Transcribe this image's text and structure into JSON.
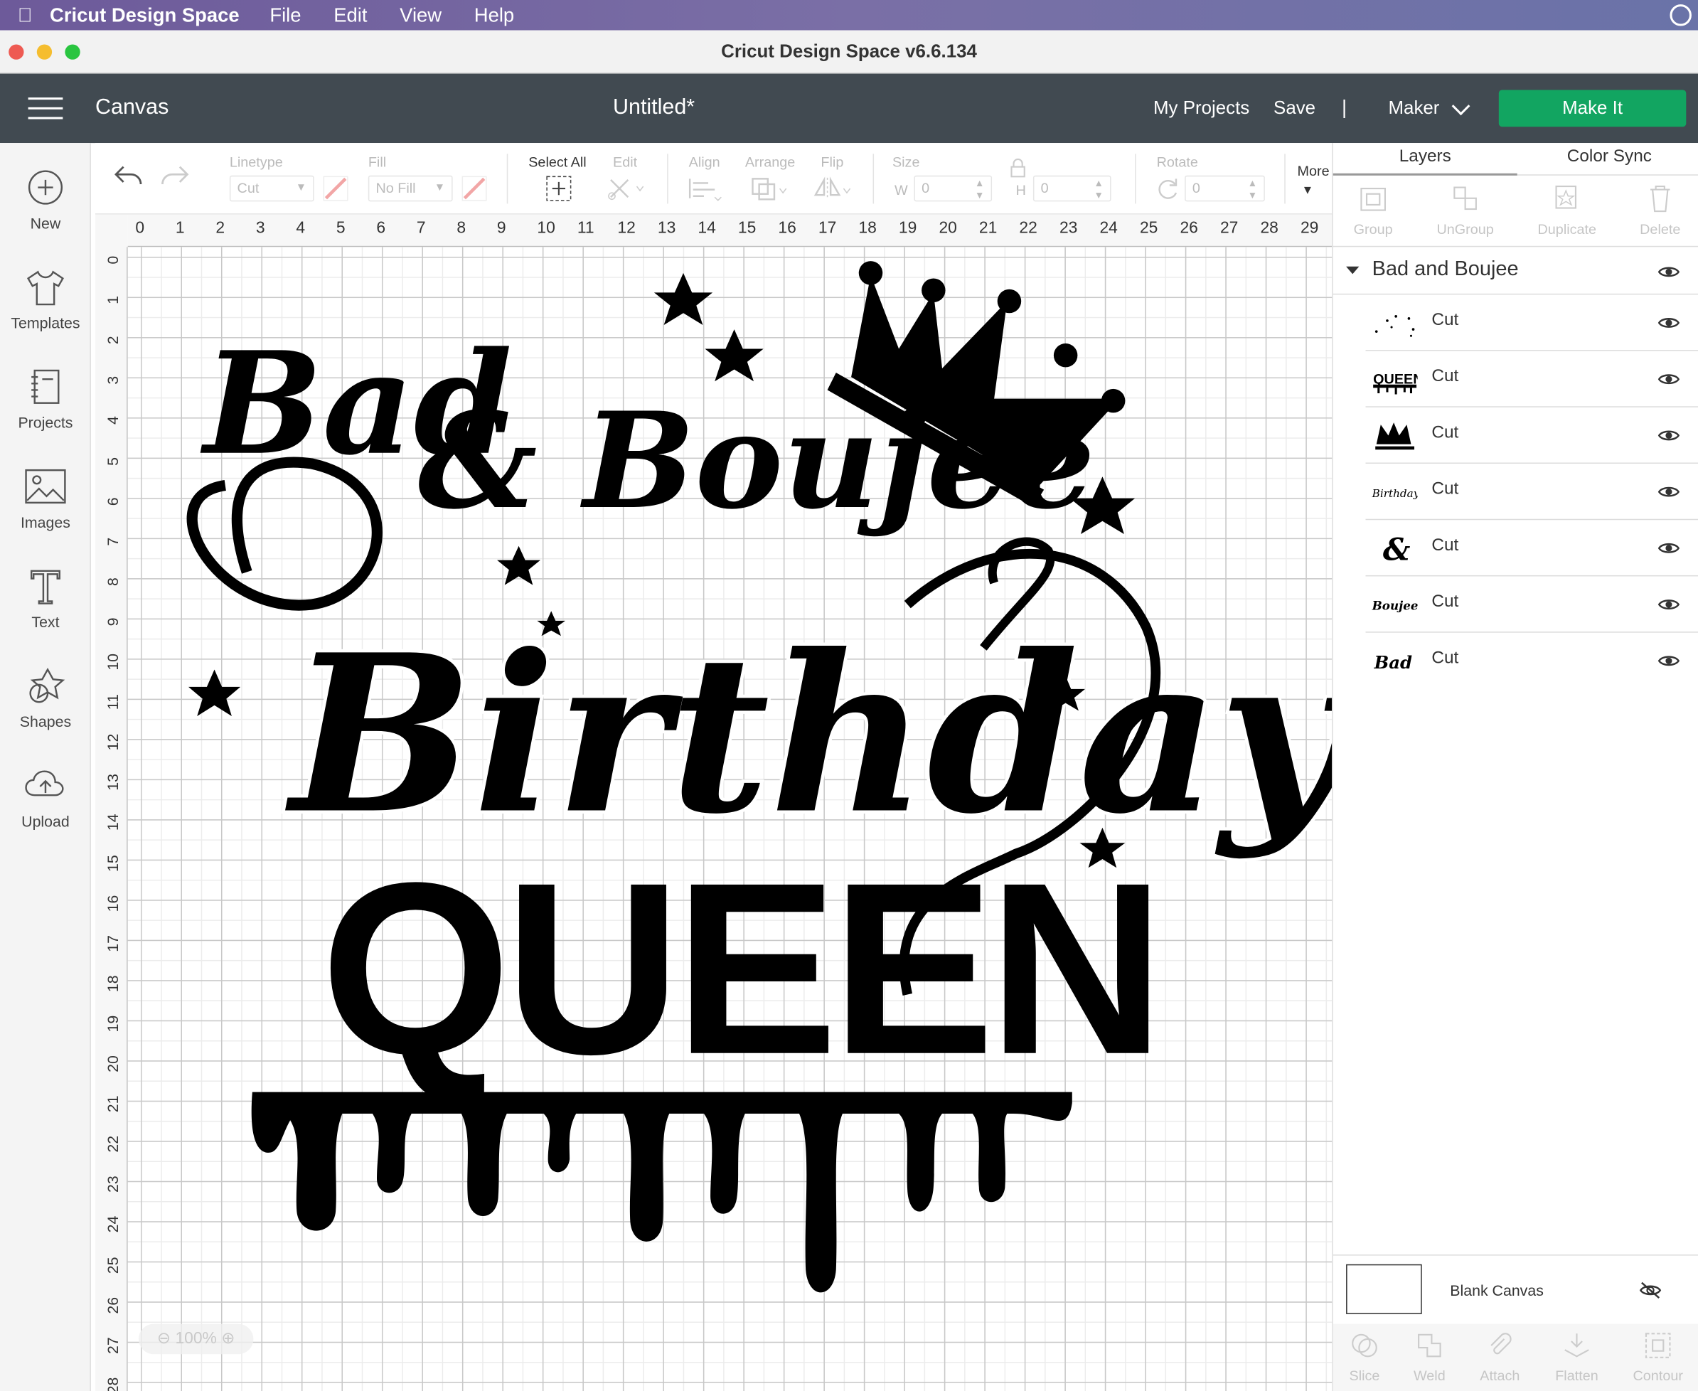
{
  "menubar": {
    "app_name": "Cricut Design Space",
    "items": [
      "File",
      "Edit",
      "View",
      "Help"
    ]
  },
  "window": {
    "title": "Cricut Design Space  v6.6.134",
    "traffic_colors": [
      "#ee5a52",
      "#f5bd2f",
      "#29c540"
    ]
  },
  "header": {
    "canvas_label": "Canvas",
    "doc_title": "Untitled*",
    "my_projects": "My Projects",
    "save": "Save",
    "separator": "|",
    "machine": "Maker",
    "make_it": "Make It",
    "make_it_color": "#12a561"
  },
  "sidebar": {
    "items": [
      {
        "label": "New",
        "icon": "plus-circle-icon"
      },
      {
        "label": "Templates",
        "icon": "tshirt-icon"
      },
      {
        "label": "Projects",
        "icon": "notebook-icon"
      },
      {
        "label": "Images",
        "icon": "image-icon"
      },
      {
        "label": "Text",
        "icon": "text-t-icon"
      },
      {
        "label": "Shapes",
        "icon": "shapes-icon"
      },
      {
        "label": "Upload",
        "icon": "cloud-upload-icon"
      }
    ]
  },
  "toolbar": {
    "linetype_label": "Linetype",
    "linetype_value": "Cut",
    "fill_label": "Fill",
    "fill_value": "No Fill",
    "select_all": "Select All",
    "edit": "Edit",
    "align": "Align",
    "arrange": "Arrange",
    "flip": "Flip",
    "size": "Size",
    "w_label": "W",
    "w_value": "0",
    "h_label": "H",
    "h_value": "0",
    "rotate": "Rotate",
    "rotate_value": "0",
    "more": "More"
  },
  "rulers": {
    "top": [
      "0",
      "1",
      "2",
      "3",
      "4",
      "5",
      "6",
      "7",
      "8",
      "9",
      "10",
      "11",
      "12",
      "13",
      "14",
      "15",
      "16",
      "17",
      "18",
      "19",
      "20",
      "21",
      "22",
      "23",
      "24",
      "25",
      "26",
      "27",
      "28",
      "29"
    ],
    "left": [
      "0",
      "1",
      "2",
      "3",
      "4",
      "5",
      "6",
      "7",
      "8",
      "9",
      "10",
      "11",
      "12",
      "13",
      "14",
      "15",
      "16",
      "17",
      "18",
      "19",
      "20",
      "21",
      "22",
      "23",
      "24",
      "25",
      "26",
      "27",
      "28"
    ]
  },
  "canvas": {
    "zoom": "100%",
    "design": {
      "line1": "Bad",
      "line2": "& Boujee",
      "line3": "Birthday",
      "line4": "QUEEN"
    }
  },
  "panel": {
    "tabs": [
      "Layers",
      "Color Sync"
    ],
    "actions": [
      "Group",
      "UnGroup",
      "Duplicate",
      "Delete"
    ],
    "group_name": "Bad and Boujee",
    "layers": [
      {
        "op": "Cut",
        "thumb": "stars"
      },
      {
        "op": "Cut",
        "thumb": "QUEEN"
      },
      {
        "op": "Cut",
        "thumb": "crown"
      },
      {
        "op": "Cut",
        "thumb": "Birthday"
      },
      {
        "op": "Cut",
        "thumb": "&"
      },
      {
        "op": "Cut",
        "thumb": "Boujee"
      },
      {
        "op": "Cut",
        "thumb": "Bad"
      }
    ],
    "blank_canvas": "Blank Canvas",
    "bottom_actions": [
      "Slice",
      "Weld",
      "Attach",
      "Flatten",
      "Contour"
    ]
  }
}
